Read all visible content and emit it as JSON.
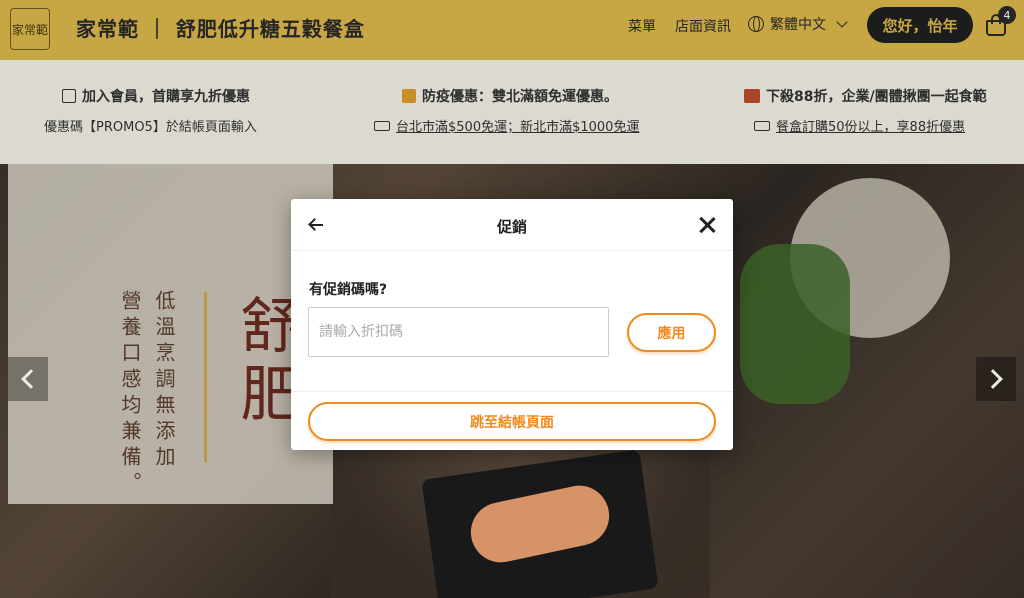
{
  "header": {
    "logo_text": "家常範",
    "brand_title": "家常範 ｜ 舒肥低升糖五穀餐盒",
    "nav_menu": "菜單",
    "nav_store": "店面資訊",
    "language": "繁體中文",
    "user_greeting": "您好，怡年",
    "cart_count": "4"
  },
  "promo": {
    "col1": {
      "title": "加入會員，首購享九折優惠",
      "sub": "優惠碼【PROMO5】於結帳頁面輸入"
    },
    "col2": {
      "title": "防疫優惠：雙北滿額免運優惠。",
      "sub": "台北市滿$500免運；新北市滿$1000免運"
    },
    "col3": {
      "title": "下殺88折，企業/團體揪團一起食範",
      "sub": "餐盒訂購50份以上，享88折優惠"
    }
  },
  "hero": {
    "vertical_text_1": "低溫烹調無添加",
    "vertical_text_2": "營養口感均兼備。",
    "big_text": "舒肥"
  },
  "modal": {
    "title": "促銷",
    "question": "有促銷碼嗎?",
    "input_placeholder": "請輸入折扣碼",
    "input_value": "",
    "apply_label": "應用",
    "checkout_label": "跳至結帳頁面"
  },
  "colors": {
    "header_bg": "#d8b64a",
    "accent": "#f08a1c",
    "user_button_bg": "#1f1f1f"
  },
  "icons": [
    "thumbs-up-icon",
    "gift-icon",
    "bento-icon",
    "pointing-hand-icon",
    "globe-icon",
    "chevron-down-icon",
    "cart-icon",
    "back-arrow-icon",
    "close-icon"
  ]
}
